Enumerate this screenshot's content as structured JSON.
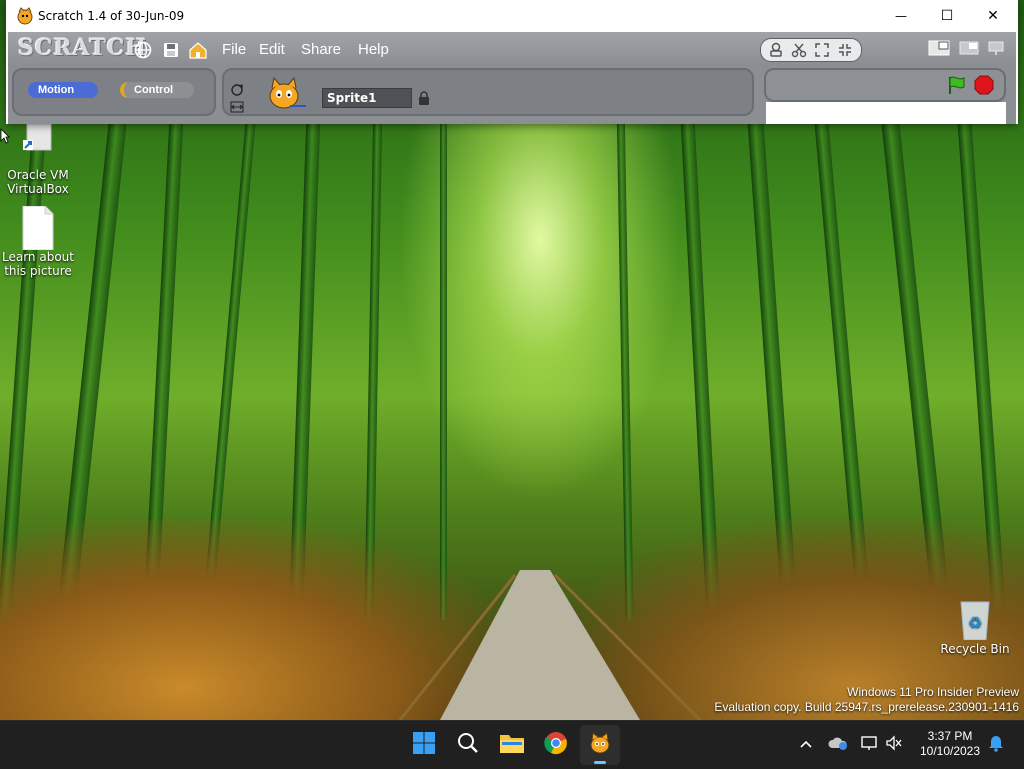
{
  "window": {
    "title": "Scratch 1.4 of 30-Jun-09",
    "minimize_glyph": "—",
    "maximize_glyph": "☐",
    "close_glyph": "✕"
  },
  "scratch": {
    "logo": "SCRATCH",
    "menus": [
      "File",
      "Edit",
      "Share",
      "Help"
    ],
    "categories": [
      "Motion",
      "Control"
    ],
    "sprite_name": "Sprite1"
  },
  "desktop_icons": [
    {
      "label_line1": "Oracle VM",
      "label_line2": "VirtualBox"
    },
    {
      "label_line1": "Learn about",
      "label_line2": "this picture"
    },
    {
      "label_line1": "Recycle Bin",
      "label_line2": ""
    }
  ],
  "watermark": {
    "line1": "Windows 11 Pro Insider Preview",
    "line2": "Evaluation copy. Build 25947.rs_prerelease.230901-1416"
  },
  "taskbar": {
    "time": "3:37 PM",
    "date": "10/10/2023"
  },
  "colors": {
    "motion": "#4a6cd4",
    "control": "#e1a91a",
    "taskbar": "#202020",
    "accent": "#0078d4"
  }
}
